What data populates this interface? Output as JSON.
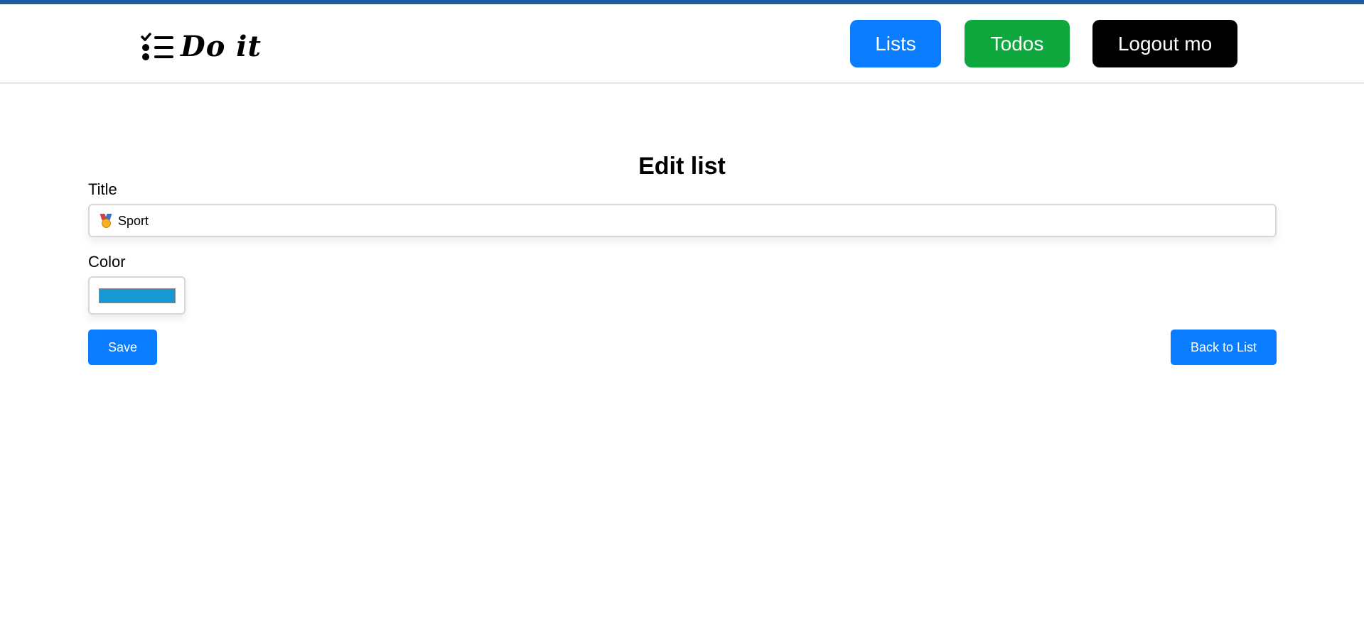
{
  "brand": {
    "name": "Do it",
    "icon": "checklist-icon"
  },
  "nav": {
    "lists_label": "Lists",
    "todos_label": "Todos",
    "logout_label": "Logout mo"
  },
  "page": {
    "title": "Edit list"
  },
  "form": {
    "title_label": "Title",
    "title_value": "Sport",
    "title_emoji": "medal-icon",
    "color_label": "Color",
    "color_value": "#1798d0"
  },
  "actions": {
    "save_label": "Save",
    "back_label": "Back to List"
  },
  "colors": {
    "top_accent": "#1f5a9e",
    "lists_button": "#0a7cff",
    "todos_button": "#0fa83f",
    "logout_button": "#000000",
    "primary_button": "#0a7cff"
  }
}
